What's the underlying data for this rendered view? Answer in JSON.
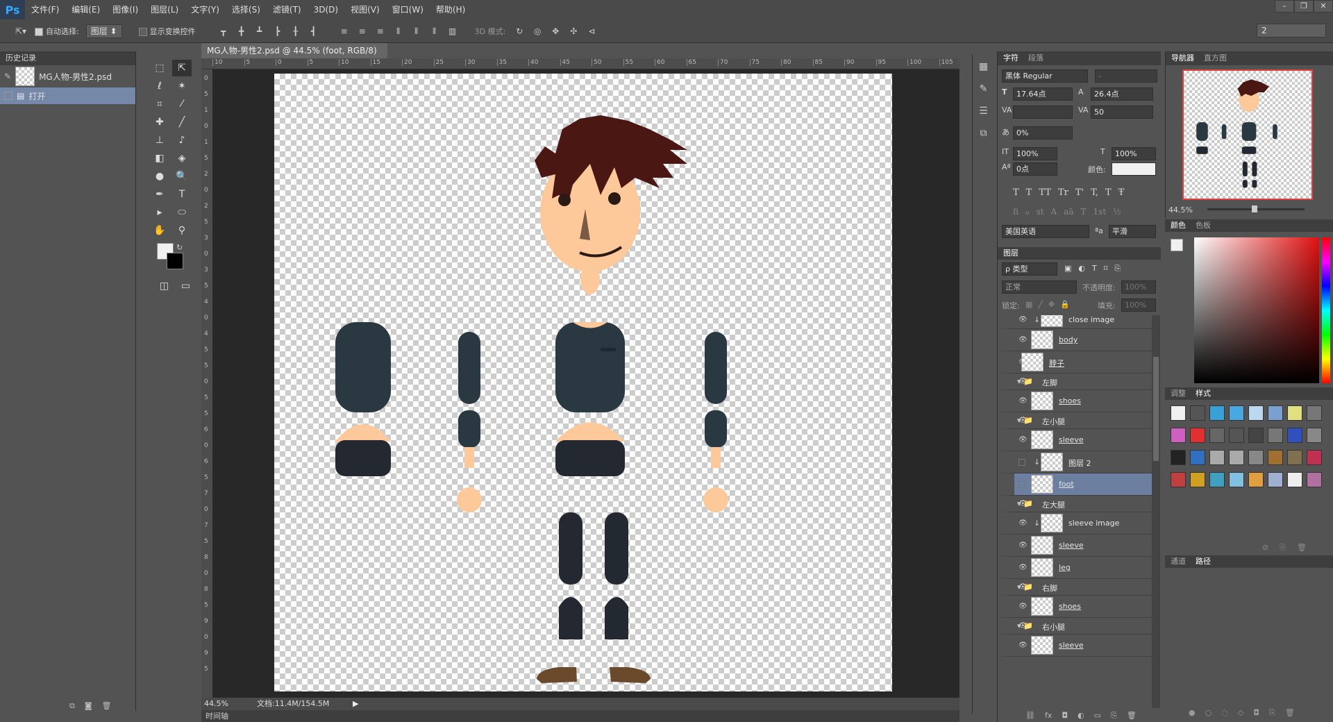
{
  "app": {
    "logo": "Ps"
  },
  "menu": [
    "文件(F)",
    "编辑(E)",
    "图像(I)",
    "图层(L)",
    "文字(Y)",
    "选择(S)",
    "滤镜(T)",
    "3D(D)",
    "视图(V)",
    "窗口(W)",
    "帮助(H)"
  ],
  "window_controls": [
    "–",
    "❐",
    "✕"
  ],
  "options": {
    "auto_select_label": "自动选择:",
    "auto_select_value": "图层",
    "show_transform_label": "显示变换控件",
    "mode_label": "3D 模式:",
    "workspace_value": "2"
  },
  "history": {
    "tab": "历史记录",
    "snapshot": "MG人物-男性2.psd",
    "items": [
      "打开"
    ]
  },
  "document": {
    "tab_label": "MG人物-男性2.psd @ 44.5% (foot, RGB/8)",
    "zoom": "44.5%",
    "doc_size": "文档:11.4M/154.5M",
    "ruler_top": [
      "10",
      "5",
      "0",
      "5",
      "10",
      "15",
      "20",
      "25",
      "30",
      "35",
      "40",
      "45",
      "50",
      "55",
      "60",
      "65",
      "70",
      "75",
      "80",
      "85",
      "90",
      "95",
      "100",
      "105"
    ],
    "ruler_left": [
      "0",
      "5",
      "1",
      "0",
      "1",
      "5",
      "2",
      "0",
      "2",
      "5",
      "3",
      "0",
      "3",
      "5",
      "4",
      "0",
      "4",
      "5",
      "5",
      "0",
      "5",
      "5",
      "6",
      "0",
      "6",
      "5",
      "7",
      "0",
      "7",
      "5",
      "8",
      "0",
      "8",
      "5",
      "9",
      "0",
      "9",
      "5"
    ]
  },
  "timeline": {
    "label": "时间轴"
  },
  "character": {
    "tabs": [
      "字符",
      "段落"
    ],
    "font": "黑体 Regular",
    "font_style": "-",
    "size": "17.64点",
    "leading": "26.4点",
    "kerning": "",
    "tracking": "50",
    "tsume": "0%",
    "vscale": "100%",
    "hscale": "100%",
    "baseline": "0点",
    "color_label": "颜色:",
    "style_buttons": [
      "T",
      "T",
      "TT",
      "Tr",
      "T'",
      "T,",
      "T",
      "Ŧ"
    ],
    "ot_buttons": [
      "fi",
      "ℴ",
      "st",
      "A",
      "aā",
      "T",
      "1st",
      "½"
    ],
    "language": "美国英语",
    "aa_label": "ªa",
    "antialias": "平滑"
  },
  "layers": {
    "tab": "图层",
    "filter": "ρ 类型",
    "blend": "正常",
    "opacity_label": "不透明度:",
    "opacity": "100%",
    "lock_label": "锁定:",
    "fill_label": "填充:",
    "fill": "100%",
    "rows": [
      {
        "name": "close image",
        "type": "clip",
        "indent": 2,
        "visible": true
      },
      {
        "name": "body",
        "type": "smart",
        "indent": 1,
        "visible": true
      },
      {
        "name": "脖子",
        "type": "smart",
        "indent": 0,
        "visible": true
      },
      {
        "name": "左脚",
        "type": "group",
        "indent": 0,
        "visible": true
      },
      {
        "name": "shoes",
        "type": "smart",
        "indent": 1,
        "visible": true
      },
      {
        "name": "左小腿",
        "type": "group",
        "indent": 0,
        "visible": true
      },
      {
        "name": "sleeve",
        "type": "smart",
        "indent": 1,
        "visible": true
      },
      {
        "name": "图层 2",
        "type": "clip",
        "indent": 2,
        "visible": false
      },
      {
        "name": "foot",
        "type": "smart",
        "indent": 1,
        "visible": false,
        "selected": true
      },
      {
        "name": "左大腿",
        "type": "group",
        "indent": 0,
        "visible": true
      },
      {
        "name": "sleeve image",
        "type": "clip",
        "indent": 2,
        "visible": true
      },
      {
        "name": "sleeve",
        "type": "smart",
        "indent": 1,
        "visible": true
      },
      {
        "name": "leg",
        "type": "smart",
        "indent": 1,
        "visible": true
      },
      {
        "name": "右脚",
        "type": "group",
        "indent": 0,
        "visible": true
      },
      {
        "name": "shoes",
        "type": "smart",
        "indent": 1,
        "visible": true
      },
      {
        "name": "右小腿",
        "type": "group",
        "indent": 0,
        "visible": true
      },
      {
        "name": "sleeve",
        "type": "smart",
        "indent": 1,
        "visible": true
      }
    ],
    "footer_icons": [
      "link-icon",
      "fx-icon",
      "mask-icon",
      "adjust-icon",
      "folder-icon",
      "new-layer-icon",
      "trash-icon"
    ]
  },
  "navigator": {
    "tabs": [
      "导航器",
      "直方图"
    ],
    "zoom": "44.5%"
  },
  "color": {
    "tabs": [
      "颜色",
      "色板"
    ],
    "foreground": "#f0f0f0",
    "background": "#000000"
  },
  "styles": {
    "tabs": [
      "调整",
      "样式"
    ]
  },
  "paths": {
    "tabs": [
      "通道",
      "路径"
    ]
  },
  "colors": {
    "hair": "#4a1713",
    "skin": "#fdc89a",
    "jacket": "#2a3842",
    "pants": "#232831",
    "shoes": "#6b4a2b",
    "selection": "#6c7fa0"
  }
}
